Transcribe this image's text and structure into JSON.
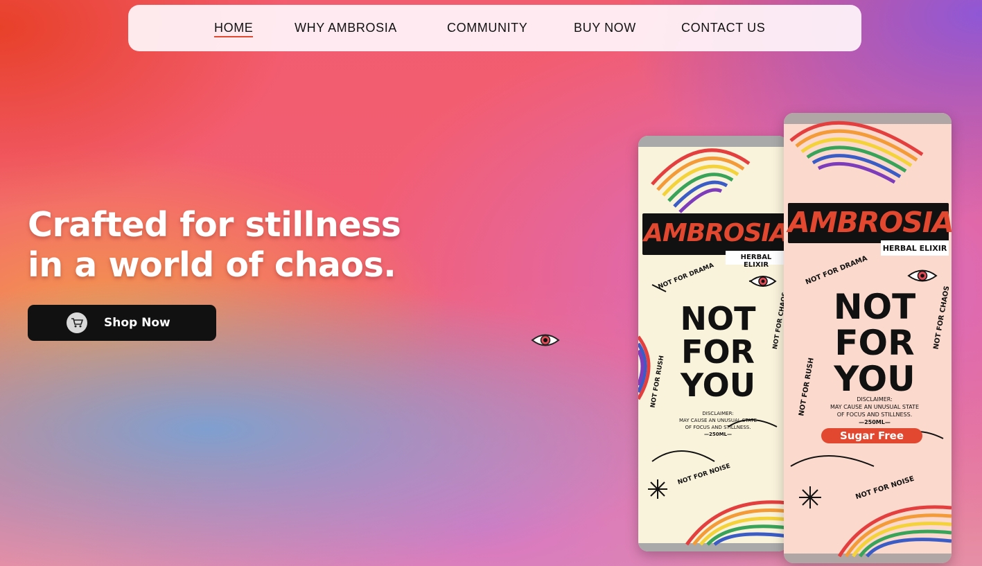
{
  "nav": {
    "items": [
      {
        "label": "HOME",
        "active": true
      },
      {
        "label": "WHY AMBROSIA",
        "active": false
      },
      {
        "label": "COMMUNITY",
        "active": false
      },
      {
        "label": "BUY NOW",
        "active": false
      },
      {
        "label": "CONTACT US",
        "active": false
      }
    ]
  },
  "hero": {
    "title_line1": "Crafted for stillness",
    "title_line2": "in a world of chaos.",
    "cta_label": "Shop Now",
    "cta_icon": "cart-icon"
  },
  "products": {
    "can_left": {
      "brand": "AMBROSIA",
      "subtitle": "HERBAL ELIXIR",
      "headline_1": "NOT",
      "headline_2": "FOR",
      "headline_3": "YOU",
      "side_1": "NOT FOR DRAMA",
      "side_2": "NOT FOR CHAOS",
      "side_3": "NOT FOR RUSH",
      "side_4": "NOT FOR NOISE",
      "disclaimer_1": "DISCLAIMER:",
      "disclaimer_2": "MAY CAUSE AN UNUSUAL STATE",
      "disclaimer_3": "OF FOCUS AND STILLNESS.",
      "volume": "—250ML—"
    },
    "can_right": {
      "brand": "AMBROSIA",
      "subtitle": "HERBAL ELIXIR",
      "headline_1": "NOT",
      "headline_2": "FOR",
      "headline_3": "YOU",
      "side_1": "NOT FOR DRAMA",
      "side_2": "NOT FOR CHAOS",
      "side_3": "NOT FOR RUSH",
      "side_4": "NOT FOR NOISE",
      "disclaimer_1": "DISCLAIMER:",
      "disclaimer_2": "MAY CAUSE AN UNUSUAL STATE",
      "disclaimer_3": "OF FOCUS AND STILLNESS.",
      "volume": "—250ML—",
      "badge": "Sugar Free"
    }
  },
  "colors": {
    "accent_underline": "#e2472f",
    "button_bg": "#111111",
    "brand_red": "#e2472f"
  }
}
